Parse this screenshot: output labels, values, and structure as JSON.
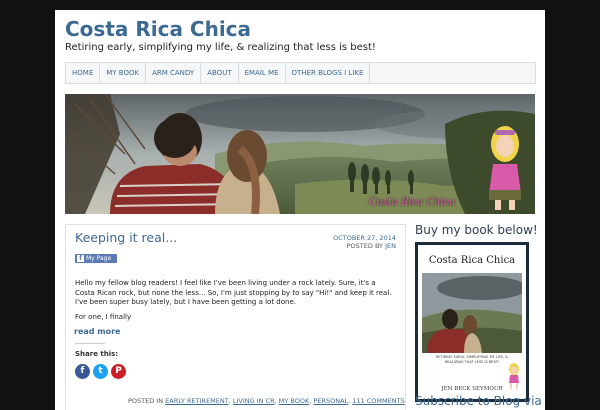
{
  "site": {
    "title": "Costa Rica Chica",
    "description": "Retiring early, simplifying my life, & realizing that less is best!"
  },
  "nav": {
    "items": [
      "HOME",
      "MY BOOK",
      "ARM CANDY",
      "ABOUT",
      "EMAIL ME",
      "OTHER BLOGS I LIKE"
    ]
  },
  "banner": {
    "caption": "Costa Rica Chica"
  },
  "post": {
    "title": "Keeping it real...",
    "date": "OCTOBER 27, 2014",
    "posted_by_label": "POSTED BY",
    "author": "JEN",
    "fb_badge": "My Page",
    "paragraph1": "Hello my fellow blog readers! I feel like I've been living under a rock lately. Sure, it's a Costa Rican rock, but none the less... So, I'm just stopping by to say \"Hi!\" and keep it real.  I've been super busy lately, but I have been getting a lot done.",
    "paragraph2": "For one, I finally",
    "read_more": "read more",
    "share_label": "Share this:",
    "share_buttons": [
      {
        "icon": "facebook-icon",
        "glyph": "f",
        "color": "#3b5998"
      },
      {
        "icon": "twitter-icon",
        "glyph": "t",
        "color": "#1da1f2"
      },
      {
        "icon": "pinterest-icon",
        "glyph": "P",
        "color": "#cb2027"
      }
    ],
    "footer_prefix": "POSTED IN",
    "categories": [
      "EARLY RETIREMENT",
      "LIVING IN CR",
      "MY BOOK",
      "PERSONAL"
    ],
    "comments": "111 COMMENTS"
  },
  "sidebar": {
    "book_heading": "Buy my book below!",
    "book_cover_title": "Costa Rica Chica",
    "book_cover_subtitle": "RETIRING EARLY, SIMPLIFYING MY LIFE, & REALIZING THAT LESS IS BEST!",
    "book_cover_author": "JEN BECK SEYMOUR",
    "subscribe_heading": "Subscribe to Blog via"
  },
  "colors": {
    "link": "#3d6a92",
    "background": "#111111"
  }
}
